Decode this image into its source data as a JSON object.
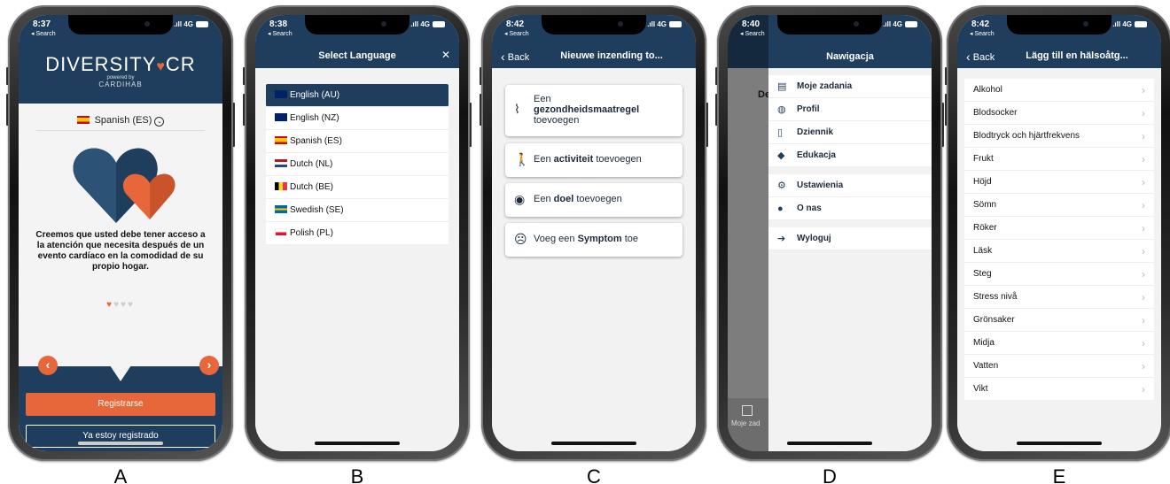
{
  "phone_a": {
    "time": "8:37",
    "back": "◂ Search",
    "signal": ".ıll 4G",
    "logo_left": "DIVERSITY",
    "logo_right": "CR",
    "powered": "powered by",
    "cardihab": "CARDIHAB",
    "language": "Spanish (ES)",
    "message": "Creemos que usted debe tener acceso a la atención que necesita después de un evento cardíaco en la comodidad de su propio hogar.",
    "register_label": "Registrarse",
    "registered_label": "Ya estoy registrado",
    "label": "A"
  },
  "phone_b": {
    "time": "8:38",
    "back": "◂ Search",
    "signal": ".ıll 4G",
    "title": "Select Language",
    "close": "✕",
    "items": [
      {
        "label": "English (AU)",
        "flag": "au"
      },
      {
        "label": "English (NZ)",
        "flag": "nz"
      },
      {
        "label": "Spanish (ES)",
        "flag": "es"
      },
      {
        "label": "Dutch (NL)",
        "flag": "nl"
      },
      {
        "label": "Dutch (BE)",
        "flag": "be"
      },
      {
        "label": "Swedish (SE)",
        "flag": "se"
      },
      {
        "label": "Polish (PL)",
        "flag": "pl"
      }
    ],
    "selected": "English (AU)",
    "label": "B"
  },
  "phone_c": {
    "time": "8:42",
    "back_search": "◂ Search",
    "signal": ".ıll 4G",
    "back": "Back",
    "title": "Nieuwe inzending to...",
    "card1_pre": "Een",
    "card1_bold": "gezondheidsmaatregel",
    "card1_post": "toevoegen",
    "card2_pre": "Een",
    "card2_bold": "activiteit",
    "card2_post": "toevoegen",
    "card3_pre": "Een",
    "card3_bold": "doel",
    "card3_post": "toevoegen",
    "card4_pre": "Voeg een",
    "card4_bold": "Symptom",
    "card4_post": "toe",
    "label": "C"
  },
  "phone_d": {
    "time": "8:40",
    "back": "◂ Search",
    "signal": ".ıll 4G",
    "title": "Nawigacja",
    "peek_text": "De",
    "items_group1": [
      "Moje zadania",
      "Profil",
      "Dziennik",
      "Edukacja"
    ],
    "items_group2": [
      "Ustawienia",
      "O nas"
    ],
    "items_group3": [
      "Wyloguj"
    ],
    "tab_label": "Moje zad",
    "label": "D"
  },
  "phone_e": {
    "time": "8:42",
    "back_search": "◂ Search",
    "signal": ".ıll 4G",
    "back": "Back",
    "title": "Lägg till en hälsoåtg...",
    "items": [
      "Alkohol",
      "Blodsocker",
      "Blodtryck och hjärtfrekvens",
      "Frukt",
      "Höjd",
      "Sömn",
      "Röker",
      "Läsk",
      "Steg",
      "Stress nivå",
      "Grönsaker",
      "Midja",
      "Vatten",
      "Vikt"
    ],
    "label": "E"
  },
  "colors": {
    "navy": "#1f3d5c",
    "accent": "#e8673a"
  }
}
